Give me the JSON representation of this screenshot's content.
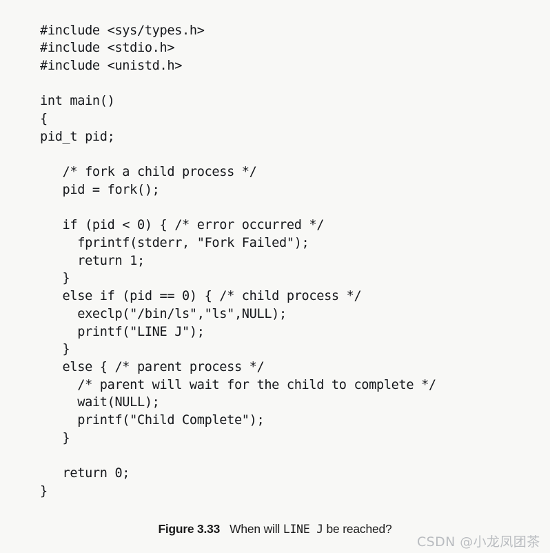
{
  "figure": {
    "background_color": "#f8f8f6",
    "text_color": "#16181c",
    "code_lines": [
      "#include <sys/types.h>",
      "#include <stdio.h>",
      "#include <unistd.h>",
      "",
      "int main()",
      "{",
      "pid_t pid;",
      "",
      "   /* fork a child process */",
      "   pid = fork();",
      "",
      "   if (pid < 0) { /* error occurred */",
      "     fprintf(stderr, \"Fork Failed\");",
      "     return 1;",
      "   }",
      "   else if (pid == 0) { /* child process */",
      "     execlp(\"/bin/ls\",\"ls\",NULL);",
      "     printf(\"LINE J\");",
      "   }",
      "   else { /* parent process */",
      "     /* parent will wait for the child to complete */",
      "     wait(NULL);",
      "     printf(\"Child Complete\");",
      "   }",
      "",
      "   return 0;",
      "}"
    ]
  },
  "caption": {
    "label": "Figure 3.33",
    "text_before": "When will ",
    "mono_text": "LINE  J",
    "text_after": " be reached?"
  },
  "watermark": {
    "text": "CSDN @小龙凤团茶",
    "color": "#b9bcc0"
  }
}
